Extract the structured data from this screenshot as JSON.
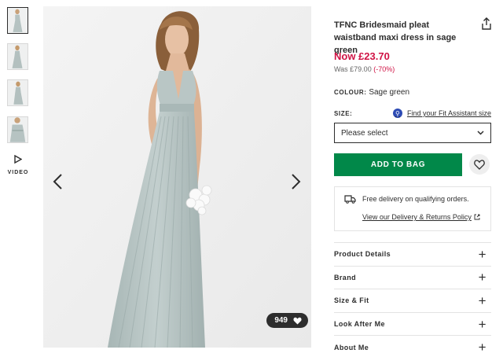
{
  "gallery": {
    "thumbnails": [
      "thumb-front",
      "thumb-back",
      "thumb-side",
      "thumb-detail"
    ],
    "video_label": "VIDEO",
    "saves_count": "949"
  },
  "product": {
    "title": "TFNC Bridesmaid pleat waistband maxi dress in sage green",
    "price_now": "Now £23.70",
    "price_was": "Was £79.00",
    "discount": "(-70%)",
    "colour_label": "COLOUR:",
    "colour_value": "Sage green",
    "size_label": "SIZE:",
    "fit_assistant_link": "Find your Fit Assistant size",
    "size_select_value": "Please select",
    "add_to_bag": "ADD TO BAG"
  },
  "delivery": {
    "text": "Free delivery on qualifying orders.",
    "policy_link": "View our Delivery & Returns Policy"
  },
  "accordion": {
    "items": [
      "Product Details",
      "Brand",
      "Size & Fit",
      "Look After Me",
      "About Me"
    ]
  },
  "colors": {
    "accent_green": "#018849",
    "sale_red": "#d01345",
    "dress_sage": "#b6c3c2",
    "text_dark": "#2d2d2d"
  },
  "icons": [
    "share-icon",
    "fit-assistant-icon",
    "chevron-down-icon",
    "heart-icon",
    "truck-icon",
    "external-link-icon",
    "plus-icon",
    "play-icon",
    "chevron-left-icon",
    "chevron-right-icon"
  ]
}
